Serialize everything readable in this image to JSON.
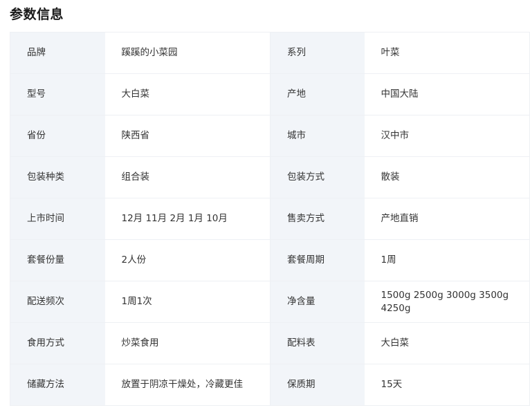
{
  "section": {
    "title": "参数信息"
  },
  "rows": [
    {
      "k1": "品牌",
      "v1": "蹊蹊的小菜园",
      "k2": "系列",
      "v2": "叶菜"
    },
    {
      "k1": "型号",
      "v1": "大白菜",
      "k2": "产地",
      "v2": "中国大陆"
    },
    {
      "k1": "省份",
      "v1": "陕西省",
      "k2": "城市",
      "v2": "汉中市"
    },
    {
      "k1": "包装种类",
      "v1": "组合装",
      "k2": "包装方式",
      "v2": "散装"
    },
    {
      "k1": "上市时间",
      "v1": "12月 11月 2月 1月 10月",
      "k2": "售卖方式",
      "v2": "产地直销"
    },
    {
      "k1": "套餐份量",
      "v1": "2人份",
      "k2": "套餐周期",
      "v2": "1周"
    },
    {
      "k1": "配送频次",
      "v1": "1周1次",
      "k2": "净含量",
      "v2": "1500g 2500g 3000g 3500g 4250g"
    },
    {
      "k1": "食用方式",
      "v1": "炒菜食用",
      "k2": "配料表",
      "v2": "大白菜"
    },
    {
      "k1": "储藏方法",
      "v1": "放置于阴凉干燥处，冷藏更佳",
      "k2": "保质期",
      "v2": "15天"
    }
  ]
}
